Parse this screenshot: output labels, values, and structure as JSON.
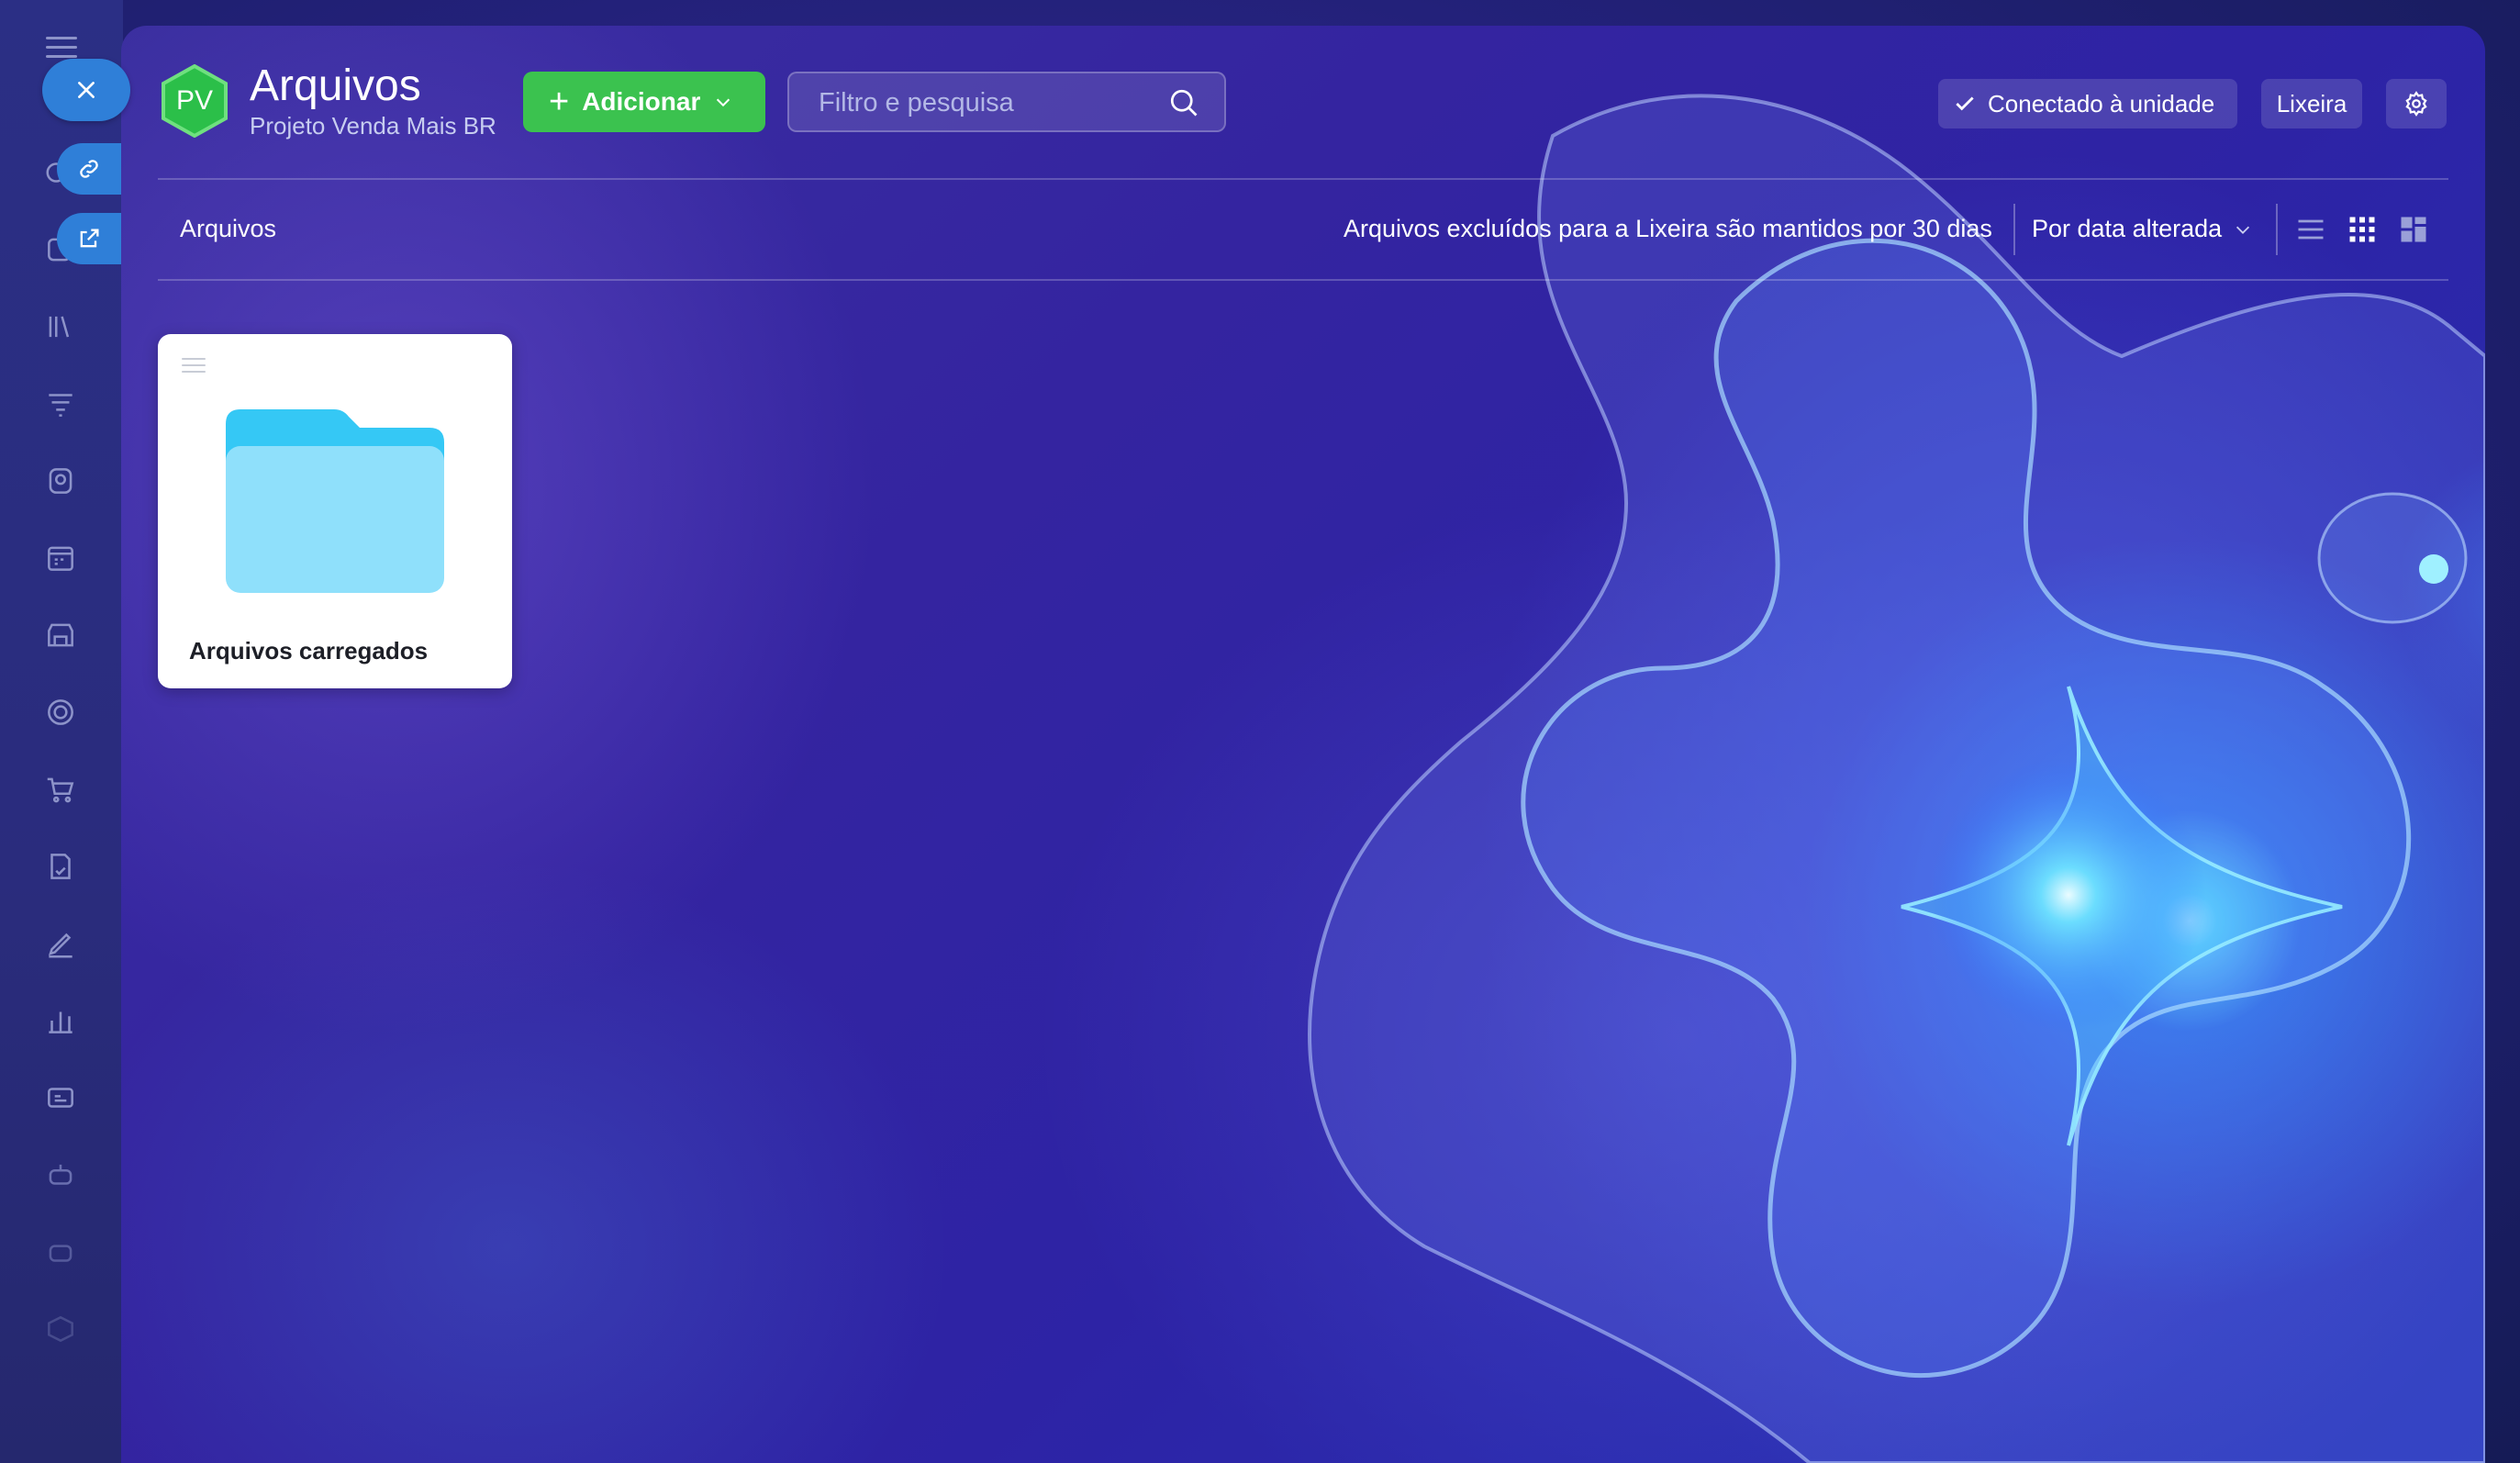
{
  "app": {
    "logo_initials": "PV",
    "title": "Arquivos",
    "subtitle": "Projeto Venda Mais BR"
  },
  "toolbar": {
    "add_label": "Adicionar",
    "search_placeholder": "Filtro e pesquisa",
    "connected_label": "Conectado à unidade",
    "trash_label": "Lixeira"
  },
  "breadcrumb": {
    "current": "Arquivos"
  },
  "notice": "Arquivos excluídos para a Lixeira são mantidos por 30 dias",
  "sort": {
    "selected": "Por data alterada"
  },
  "files": [
    {
      "name": "Arquivos carregados",
      "type": "folder"
    }
  ],
  "sidebar": {
    "icons": [
      "menu-icon",
      "chat-icon",
      "calendar-icon",
      "library-icon",
      "funnel-icon",
      "contacts-icon",
      "schedule-icon",
      "store-icon",
      "target-icon",
      "cart-icon",
      "document-sign-icon",
      "pen-icon",
      "analytics-icon",
      "cards-icon",
      "robot-icon",
      "bot-icon",
      "box-icon"
    ]
  },
  "colors": {
    "accent_blue": "#2f7fd8",
    "add_green": "#3bc24f",
    "folder_blue": "#8fe0fb",
    "folder_tab_blue": "#35c8f5"
  }
}
